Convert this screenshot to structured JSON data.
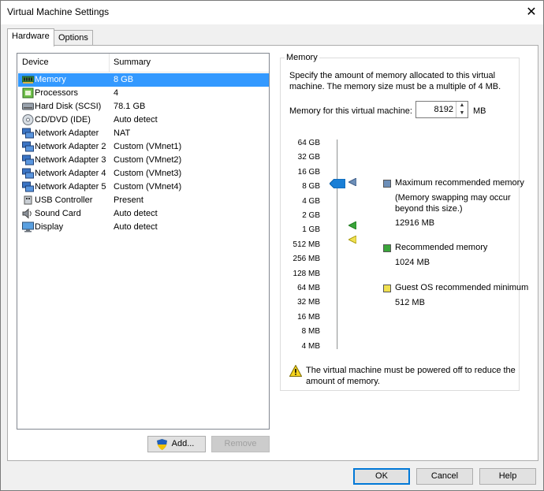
{
  "window": {
    "title": "Virtual Machine Settings",
    "close_glyph": "✕"
  },
  "tabs": [
    {
      "label": "Hardware",
      "active": true
    },
    {
      "label": "Options",
      "active": false
    }
  ],
  "device_list": {
    "headers": {
      "device": "Device",
      "summary": "Summary"
    },
    "items": [
      {
        "name": "Memory",
        "summary": "8 GB",
        "icon": "memory-icon",
        "selected": true
      },
      {
        "name": "Processors",
        "summary": "4",
        "icon": "processor-icon"
      },
      {
        "name": "Hard Disk (SCSI)",
        "summary": "78.1 GB",
        "icon": "hard-disk-icon"
      },
      {
        "name": "CD/DVD (IDE)",
        "summary": "Auto detect",
        "icon": "cd-dvd-icon"
      },
      {
        "name": "Network Adapter",
        "summary": "NAT",
        "icon": "network-adapter-icon"
      },
      {
        "name": "Network Adapter 2",
        "summary": "Custom (VMnet1)",
        "icon": "network-adapter-icon"
      },
      {
        "name": "Network Adapter 3",
        "summary": "Custom (VMnet2)",
        "icon": "network-adapter-icon"
      },
      {
        "name": "Network Adapter 4",
        "summary": "Custom (VMnet3)",
        "icon": "network-adapter-icon"
      },
      {
        "name": "Network Adapter 5",
        "summary": "Custom (VMnet4)",
        "icon": "network-adapter-icon"
      },
      {
        "name": "USB Controller",
        "summary": "Present",
        "icon": "usb-icon"
      },
      {
        "name": "Sound Card",
        "summary": "Auto detect",
        "icon": "speaker-icon"
      },
      {
        "name": "Display",
        "summary": "Auto detect",
        "icon": "monitor-icon"
      }
    ],
    "add_label": "Add...",
    "remove_label": "Remove"
  },
  "memory": {
    "group_title": "Memory",
    "description": "Specify the amount of memory allocated to this virtual machine. The memory size must be a multiple of 4 MB.",
    "field_label": "Memory for this virtual machine:",
    "value": "8192",
    "unit": "MB",
    "scale_ticks": [
      "64 GB",
      "32 GB",
      "16 GB",
      "8 GB",
      "4 GB",
      "2 GB",
      "1 GB",
      "512 MB",
      "256 MB",
      "128 MB",
      "64 MB",
      "32 MB",
      "16 MB",
      "8 MB",
      "4 MB"
    ],
    "slider_selected": "8 GB",
    "legend": {
      "max": {
        "label": "Maximum recommended memory",
        "note": "(Memory swapping may occur beyond this size.)",
        "value": "12916 MB",
        "color": "#6d8fb8"
      },
      "recommended": {
        "label": "Recommended memory",
        "value": "1024 MB",
        "color": "#3aa53a"
      },
      "guest_min": {
        "label": "Guest OS recommended minimum",
        "value": "512 MB",
        "color": "#f0e050"
      }
    },
    "warning": "The virtual machine must be powered off to reduce the amount of memory."
  },
  "footer": {
    "ok_label": "OK",
    "cancel_label": "Cancel",
    "help_label": "Help"
  },
  "colors": {
    "selection": "#3399ff",
    "accent": "#0078d7"
  }
}
